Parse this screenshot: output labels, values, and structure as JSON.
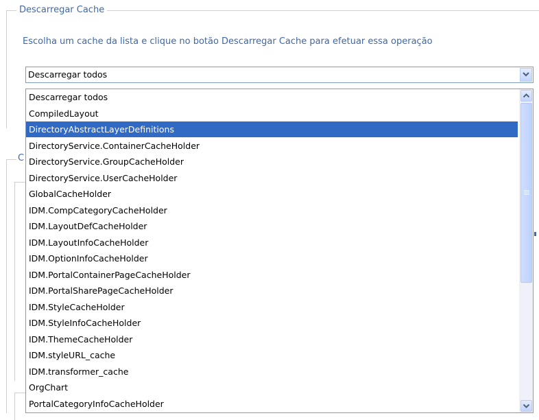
{
  "group": {
    "legend": "Descarregar Cache",
    "description": "Escolha um cache da lista e clique no botão Descarregar Cache para efetuar essa operação"
  },
  "group2": {
    "legend_visible": "C"
  },
  "select": {
    "selected_value": "Descarregar todos",
    "highlighted_option": "DirectoryAbstractLayerDefinitions",
    "options": [
      "Descarregar todos",
      "CompiledLayout",
      "DirectoryAbstractLayerDefinitions",
      "DirectoryService.ContainerCacheHolder",
      "DirectoryService.GroupCacheHolder",
      "DirectoryService.UserCacheHolder",
      "GlobalCacheHolder",
      "IDM.CompCategoryCacheHolder",
      "IDM.LayoutDefCacheHolder",
      "IDM.LayoutInfoCacheHolder",
      "IDM.OptionInfoCacheHolder",
      "IDM.PortalContainerPageCacheHolder",
      "IDM.PortalSharePageCacheHolder",
      "IDM.StyleCacheHolder",
      "IDM.StyleInfoCacheHolder",
      "IDM.ThemeCacheHolder",
      "IDM.styleURL_cache",
      "IDM.transformer_cache",
      "OrgChart",
      "PortalCategoryInfoCacheHolder"
    ]
  },
  "icons": {
    "dropdown_button": "chevron-down-icon",
    "scroll_up": "chevron-up-icon",
    "scroll_down": "chevron-down-icon"
  },
  "colors": {
    "label_blue": "#3f68a8",
    "highlight": "#316ac5",
    "border": "#7f9db9"
  }
}
